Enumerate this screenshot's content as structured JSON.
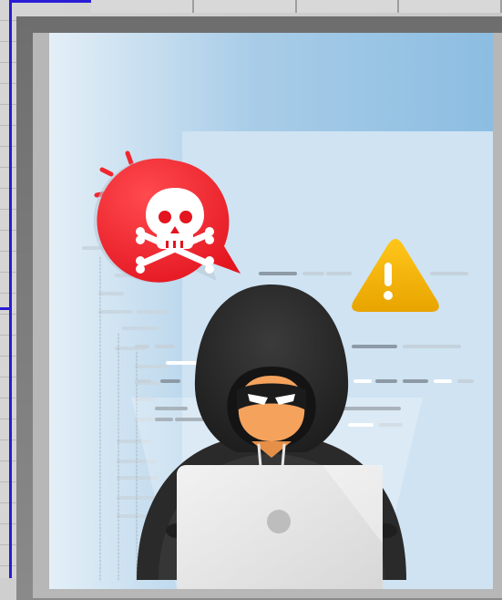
{
  "illustration": {
    "subject": "hooded-hacker-with-laptop",
    "alerts": [
      "skull-and-crossbones-icon",
      "warning-triangle-icon"
    ]
  },
  "colors": {
    "background_light": "#dbeaf5",
    "background_blue": "#9cc6e4",
    "skull_bubble": "#f0262f",
    "warning": "#f5b800",
    "hood": "#2c2c2c",
    "laptop": "#e9e9e9",
    "selection_border": "#2a1bd6"
  }
}
